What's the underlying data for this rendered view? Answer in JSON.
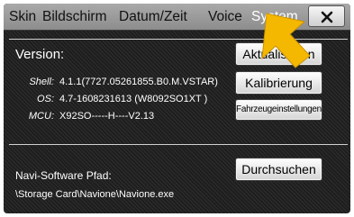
{
  "tabs": [
    {
      "label": "Skin",
      "active": false
    },
    {
      "label": "Bildschirm",
      "active": false
    },
    {
      "label": "Datum/Zeit",
      "active": false
    },
    {
      "label": "Voice",
      "active": false
    },
    {
      "label": "System",
      "active": true
    }
  ],
  "close_button": {
    "icon": "close-icon"
  },
  "version": {
    "title": "Version:",
    "shell_label": "Shell:",
    "shell_value": "4.1.1(7727.05261855.B0.M.VSTAR)",
    "os_label": "OS:",
    "os_value": "4.7-1608231613 (W8092SO1XT  )",
    "mcu_label": "MCU:",
    "mcu_value": "X92SO-----H----V2.13"
  },
  "buttons": {
    "update": "Aktualisieren",
    "calibrate": "Kalibrierung",
    "vehicle_settings": "Fahrzeugeinstellungen",
    "browse": "Durchsuchen"
  },
  "navi": {
    "title": "Navi-Software Pfad:",
    "path": "\\Storage Card\\Navione\\Navione.exe"
  },
  "colors": {
    "background": "#262626",
    "tabbar": "#9c9c9c",
    "active_tab": "#ffffff",
    "pointer_arrow": "#f5b800"
  }
}
